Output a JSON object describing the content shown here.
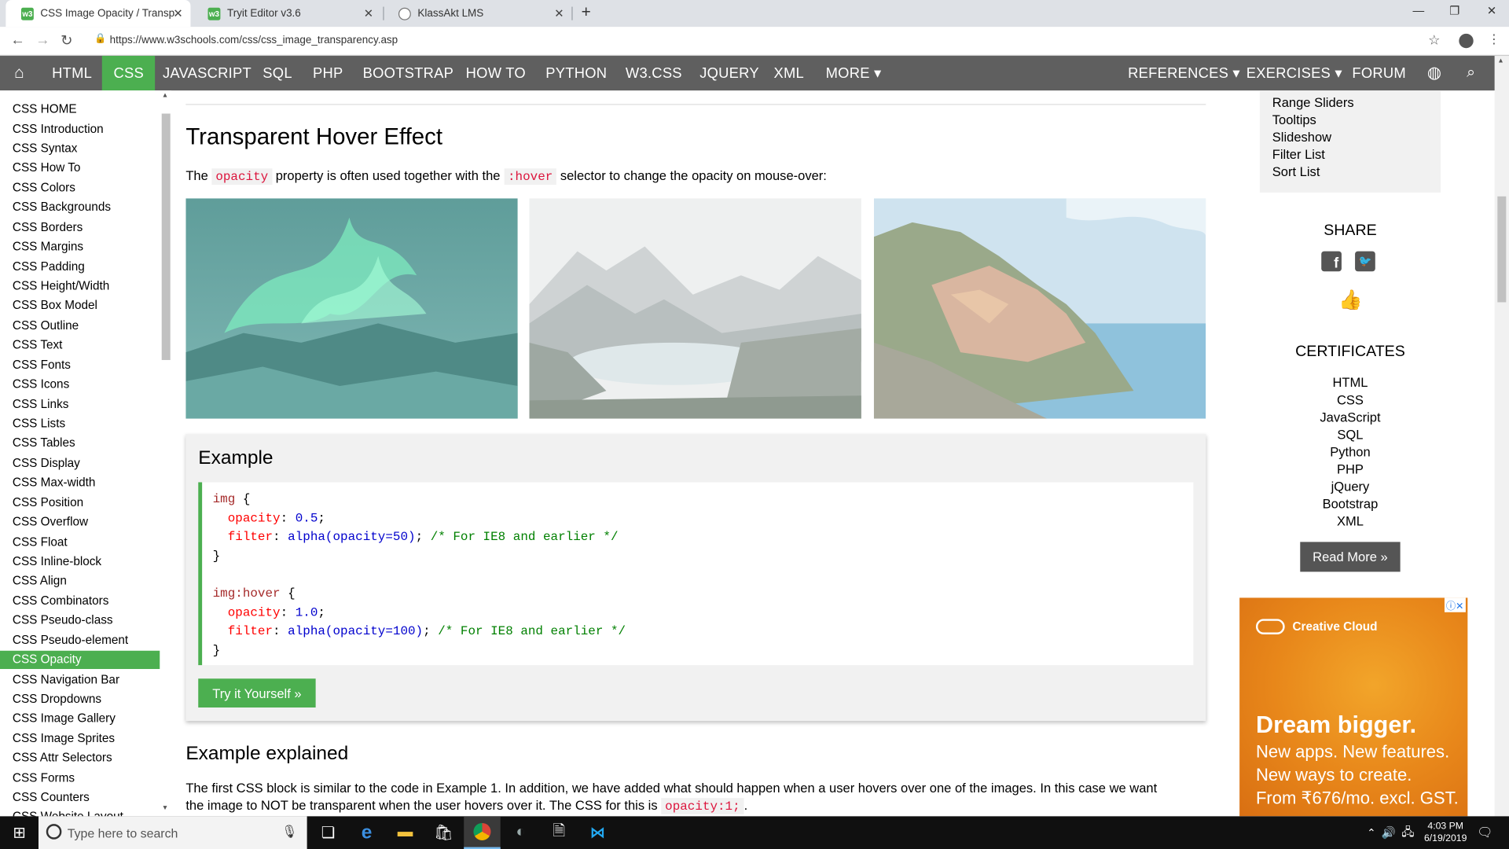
{
  "browser": {
    "tabs": [
      {
        "title": "CSS Image Opacity / Transparenc",
        "active": true
      },
      {
        "title": "Tryit Editor v3.6",
        "active": false
      },
      {
        "title": "KlassAkt LMS",
        "active": false
      }
    ],
    "url": "https://www.w3schools.com/css/css_image_transparency.asp"
  },
  "topnav": {
    "items": [
      "HTML",
      "CSS",
      "JAVASCRIPT",
      "SQL",
      "PHP",
      "BOOTSTRAP",
      "HOW TO",
      "PYTHON",
      "W3.CSS",
      "JQUERY",
      "XML",
      "MORE ▾"
    ],
    "right_items": [
      "REFERENCES ▾",
      "EXERCISES ▾",
      "FORUM"
    ]
  },
  "sidebar": {
    "items": [
      "CSS HOME",
      "CSS Introduction",
      "CSS Syntax",
      "CSS How To",
      "CSS Colors",
      "CSS Backgrounds",
      "CSS Borders",
      "CSS Margins",
      "CSS Padding",
      "CSS Height/Width",
      "CSS Box Model",
      "CSS Outline",
      "CSS Text",
      "CSS Fonts",
      "CSS Icons",
      "CSS Links",
      "CSS Lists",
      "CSS Tables",
      "CSS Display",
      "CSS Max-width",
      "CSS Position",
      "CSS Overflow",
      "CSS Float",
      "CSS Inline-block",
      "CSS Align",
      "CSS Combinators",
      "CSS Pseudo-class",
      "CSS Pseudo-element",
      "CSS Opacity",
      "CSS Navigation Bar",
      "CSS Dropdowns",
      "CSS Image Gallery",
      "CSS Image Sprites",
      "CSS Attr Selectors",
      "CSS Forms",
      "CSS Counters",
      "CSS Website Layout"
    ],
    "active": "CSS Opacity"
  },
  "main": {
    "section_title": "Transparent Hover Effect",
    "intro_text_1": "The",
    "intro_code_1": "opacity",
    "intro_text_2": "property is often used together with the",
    "intro_code_2": ":hover",
    "intro_text_3": "selector to change the opacity on mouse-over:",
    "example": {
      "title": "Example",
      "code": {
        "l1_sel": "img",
        "l1_brace": " {",
        "l2_prop": "opacity",
        "l2_val": " 0.5",
        "l3_prop": "filter",
        "l3_val": " alpha(opacity=50)",
        "l3_cmt": "/* For IE8 and earlier */",
        "l4": "}",
        "l6_sel": "img:hover",
        "l6_brace": " {",
        "l7_prop": "opacity",
        "l7_val": " 1.0",
        "l8_prop": "filter",
        "l8_val": " alpha(opacity=100)",
        "l8_cmt": "/* For IE8 and earlier */",
        "l9": "}"
      },
      "try_button": "Try it Yourself »"
    },
    "explained_title": "Example explained",
    "explained_text_1": "The first CSS block is similar to the code in Example 1. In addition, we have added what should happen when a user hovers over one of the images. In this case we want",
    "explained_text_2": "the image to NOT be transparent when the user hovers over it. The CSS for this is",
    "explained_code": "opacity:1;",
    "explained_end": "."
  },
  "right": {
    "menu_items": [
      "Range Sliders",
      "Tooltips",
      "Slideshow",
      "Filter List",
      "Sort List"
    ],
    "share_title": "SHARE",
    "certificates_title": "CERTIFICATES",
    "certificates": [
      "HTML",
      "CSS",
      "JavaScript",
      "SQL",
      "Python",
      "PHP",
      "jQuery",
      "Bootstrap",
      "XML"
    ],
    "read_more": "Read More »",
    "ad": {
      "brand": "Creative Cloud",
      "headline": "Dream bigger.",
      "line1": "New apps. New features.",
      "line2": "New ways to create.",
      "line3": "From ₹676/mo. excl. GST."
    }
  },
  "taskbar": {
    "search_placeholder": "Type here to search",
    "time": "4:03 PM",
    "date": "6/19/2019"
  },
  "colors": {
    "accent": "#4caf50",
    "nav": "#5f5f5f",
    "code_keyword": "#a52a2a"
  }
}
